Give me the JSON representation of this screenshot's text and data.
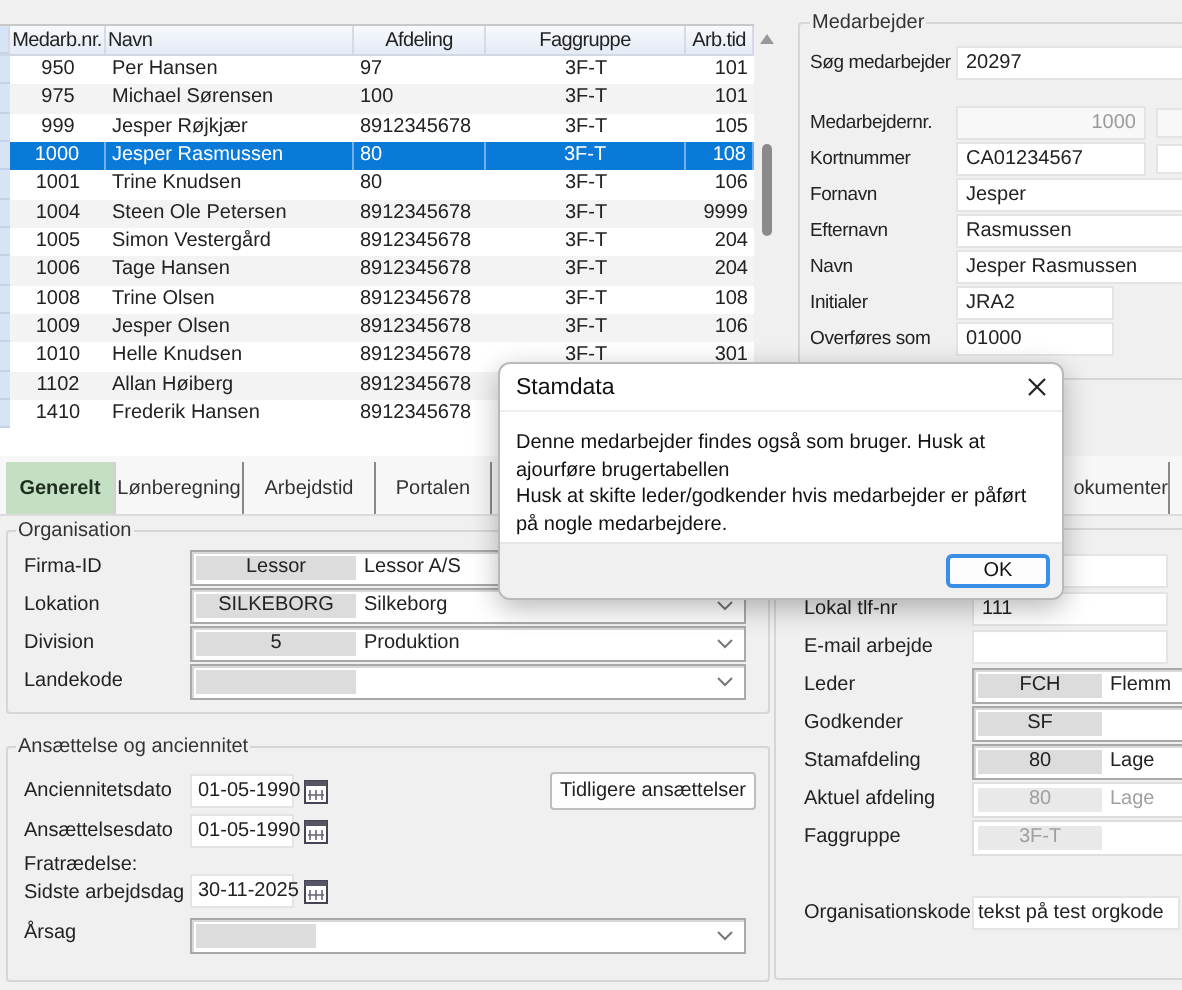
{
  "employee_table": {
    "columns": [
      "Medarb.nr.",
      "Navn",
      "Afdeling",
      "Faggruppe",
      "Arb.tid"
    ],
    "rows": [
      {
        "cells": [
          "950",
          "Per Hansen",
          "97",
          "3F-T",
          "101"
        ],
        "selected": false
      },
      {
        "cells": [
          "975",
          "Michael Sørensen",
          "100",
          "3F-T",
          "101"
        ],
        "selected": false
      },
      {
        "cells": [
          "999",
          "Jesper Røjkjær",
          "8912345678",
          "3F-T",
          "105"
        ],
        "selected": false
      },
      {
        "cells": [
          "1000",
          "Jesper Rasmussen",
          "80",
          "3F-T",
          "108"
        ],
        "selected": true
      },
      {
        "cells": [
          "1001",
          "Trine Knudsen",
          "80",
          "3F-T",
          "106"
        ],
        "selected": false
      },
      {
        "cells": [
          "1004",
          "Steen Ole Petersen",
          "8912345678",
          "3F-T",
          "9999"
        ],
        "selected": false
      },
      {
        "cells": [
          "1005",
          "Simon Vestergård",
          "8912345678",
          "3F-T",
          "204"
        ],
        "selected": false
      },
      {
        "cells": [
          "1006",
          "Tage Hansen",
          "8912345678",
          "3F-T",
          "204"
        ],
        "selected": false
      },
      {
        "cells": [
          "1008",
          "Trine Olsen",
          "8912345678",
          "3F-T",
          "108"
        ],
        "selected": false
      },
      {
        "cells": [
          "1009",
          "Jesper Olsen",
          "8912345678",
          "3F-T",
          "106"
        ],
        "selected": false
      },
      {
        "cells": [
          "1010",
          "Helle Knudsen",
          "8912345678",
          "3F-T",
          "301"
        ],
        "selected": false
      },
      {
        "cells": [
          "1102",
          "Allan Høiberg",
          "8912345678"
        ],
        "selected": false
      },
      {
        "cells": [
          "1410",
          "Frederik Hansen",
          "8912345678"
        ],
        "selected": false
      }
    ]
  },
  "employee_panel": {
    "title": "Medarbejder",
    "fields": [
      {
        "kind": "search",
        "label": "Søg medarbejder",
        "value": "20297",
        "disabled": false
      },
      {
        "kind": "number",
        "label": "Medarbejdernr.",
        "value": "1000",
        "disabled": true
      },
      {
        "kind": "boxed",
        "label": "Kortnummer",
        "value": "CA01234567",
        "disabled": false
      },
      {
        "kind": "text",
        "label": "Fornavn",
        "value": "Jesper",
        "disabled": false
      },
      {
        "kind": "text",
        "label": "Efternavn",
        "value": "Rasmussen",
        "disabled": false
      },
      {
        "kind": "text",
        "label": "Navn",
        "value": "Jesper Rasmussen",
        "disabled": false
      },
      {
        "kind": "short",
        "label": "Initialer",
        "value": "JRA2",
        "disabled": false
      },
      {
        "kind": "short",
        "label": "Overføres som",
        "value": "01000",
        "disabled": false
      }
    ]
  },
  "tabs": [
    {
      "label": "Generelt",
      "selected": true
    },
    {
      "label": "Lønberegning",
      "selected": false
    },
    {
      "label": "Arbejdstid",
      "selected": false
    },
    {
      "label": "Portalen",
      "selected": false
    },
    {
      "label": "okumenter",
      "selected": false
    }
  ],
  "organisation": {
    "title": "Organisation",
    "rows": [
      {
        "label": "Firma-ID",
        "code": "Lessor",
        "name": "Lessor A/S"
      },
      {
        "label": "Lokation",
        "code": "SILKEBORG",
        "name": "Silkeborg",
        "arrow": true
      },
      {
        "label": "Division",
        "code": "5",
        "name": "Produktion",
        "arrow": true
      },
      {
        "label": "Landekode",
        "arrow": true
      }
    ]
  },
  "employment": {
    "title": "Ansættelse og anciennitet",
    "dates": [
      {
        "label": "Anciennitetsdato",
        "value": "01-05-1990"
      },
      {
        "label": "Ansættelsesdato",
        "value": "01-05-1990"
      },
      {
        "label": "Fratrædelse:\nSidste arbejdsdag",
        "value": "30-11-2025"
      }
    ],
    "button": "Tidligere ansættelser",
    "cause": {
      "label": "Årsag",
      "arrow": true
    }
  },
  "details": {
    "rows": [
      {
        "kind": "field"
      },
      {
        "kind": "field",
        "label": "Lokal tlf-nr",
        "value": "111"
      },
      {
        "kind": "field",
        "label": "E-mail arbejde"
      },
      {
        "kind": "lookup",
        "label": "Leder",
        "code": "FCH",
        "name": "Flemm",
        "disabled": false
      },
      {
        "kind": "lookup",
        "label": "Godkender",
        "code": "SF",
        "disabled": false
      },
      {
        "kind": "lookup",
        "label": "Stamafdeling",
        "code": "80",
        "name": "Lage",
        "disabled": false
      },
      {
        "kind": "lookup",
        "label": "Aktuel afdeling",
        "code": "80",
        "name": "Lage",
        "disabled": true
      },
      {
        "kind": "lookup",
        "label": "Faggruppe",
        "code": "3F-T",
        "disabled": true
      },
      {
        "kind": "field",
        "label": "Organisationskode",
        "value": "tekst på test orgkode",
        "gap": true
      }
    ]
  },
  "dialog": {
    "title": "Stamdata",
    "message": [
      "Denne medarbejder findes også som bruger. Husk at ajourføre brugertabellen",
      "Husk at skifte leder/godkender hvis medarbejder er påført på nogle medarbejdere."
    ],
    "button": "OK"
  }
}
